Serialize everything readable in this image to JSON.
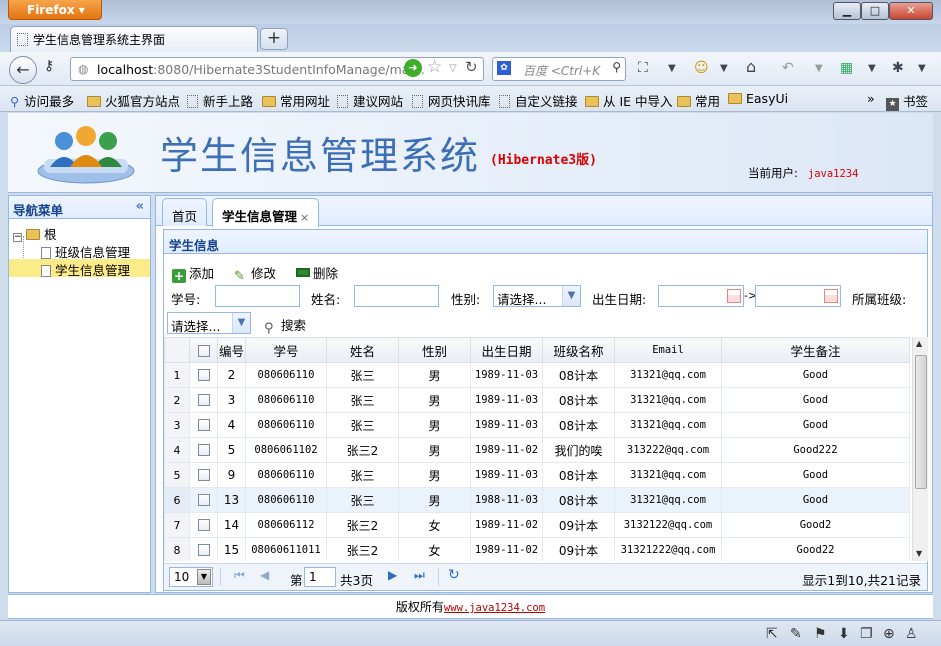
{
  "browser": {
    "app_button": "Firefox",
    "tab_title": "学生信息管理系统主界面",
    "new_tab": "+",
    "url_host": "localhost",
    "url_rest": ":8080/Hibernate3StudentInfoManage/main.",
    "search_placeholder": "百度 <Ctrl+K",
    "bookmarks": [
      "访问最多",
      "火狐官方站点",
      "新手上路",
      "常用网址",
      "建议网站",
      "网页快讯库",
      "自定义链接",
      "从 IE 中导入",
      "常用",
      "EasyUi"
    ],
    "bookmarks_menu": "书签",
    "overflow": "»"
  },
  "header": {
    "system_name": "学生信息管理系统",
    "edition": "(Hibernate3版)",
    "current_user_label": "当前用户:",
    "current_user": "java1234"
  },
  "nav": {
    "title": "导航菜单",
    "collapse": "«",
    "root": "根",
    "items": [
      "班级信息管理",
      "学生信息管理"
    ]
  },
  "tabs": {
    "home": "首页",
    "active": "学生信息管理",
    "close": "×"
  },
  "grid": {
    "title": "学生信息",
    "toolbar": {
      "add": "添加",
      "edit": "修改",
      "delete": "删除"
    },
    "search": {
      "stu_no_label": "学号:",
      "name_label": "姓名:",
      "sex_label": "性别:",
      "sex_value": "请选择...",
      "birth_label": "出生日期:",
      "arrow": "->",
      "class_label": "所属班级:",
      "class_value": "请选择...",
      "search_button": "搜索"
    },
    "columns": [
      "编号",
      "学号",
      "姓名",
      "性别",
      "出生日期",
      "班级名称",
      "Email",
      "学生备注"
    ],
    "rows": [
      {
        "rn": "1",
        "id": "2",
        "no": "080606110",
        "name": "张三",
        "sex": "男",
        "birth": "1989-11-03",
        "cls": "08计本",
        "email": "31321@qq.com",
        "note": "Good"
      },
      {
        "rn": "2",
        "id": "3",
        "no": "080606110",
        "name": "张三",
        "sex": "男",
        "birth": "1989-11-03",
        "cls": "08计本",
        "email": "31321@qq.com",
        "note": "Good"
      },
      {
        "rn": "3",
        "id": "4",
        "no": "080606110",
        "name": "张三",
        "sex": "男",
        "birth": "1989-11-03",
        "cls": "08计本",
        "email": "31321@qq.com",
        "note": "Good"
      },
      {
        "rn": "4",
        "id": "5",
        "no": "0806061102",
        "name": "张三2",
        "sex": "男",
        "birth": "1989-11-02",
        "cls": "我们的唉",
        "email": "313222@qq.com",
        "note": "Good222"
      },
      {
        "rn": "5",
        "id": "9",
        "no": "080606110",
        "name": "张三",
        "sex": "男",
        "birth": "1989-11-03",
        "cls": "08计本",
        "email": "31321@qq.com",
        "note": "Good"
      },
      {
        "rn": "6",
        "id": "13",
        "no": "080606110",
        "name": "张三",
        "sex": "男",
        "birth": "1988-11-03",
        "cls": "08计本",
        "email": "31321@qq.com",
        "note": "Good"
      },
      {
        "rn": "7",
        "id": "14",
        "no": "080606112",
        "name": "张三2",
        "sex": "女",
        "birth": "1989-11-02",
        "cls": "09计本",
        "email": "3132122@qq.com",
        "note": "Good2"
      },
      {
        "rn": "8",
        "id": "15",
        "no": "08060611011",
        "name": "张三2",
        "sex": "女",
        "birth": "1989-11-02",
        "cls": "09计本",
        "email": "31321222@qq.com",
        "note": "Good22"
      }
    ],
    "highlighted_row": 6,
    "pager": {
      "page_size": "10",
      "page_prefix": "第",
      "page_value": "1",
      "page_total": "共3页",
      "summary": "显示1到10,共21记录"
    }
  },
  "footer": {
    "copyright": "版权所有",
    "link": "www.java1234.com"
  },
  "colors": {
    "accent": "#3c6fb5",
    "edition_red": "#dd0000",
    "nav_selected": "#fbec88",
    "panel_border": "#95b8e7"
  }
}
